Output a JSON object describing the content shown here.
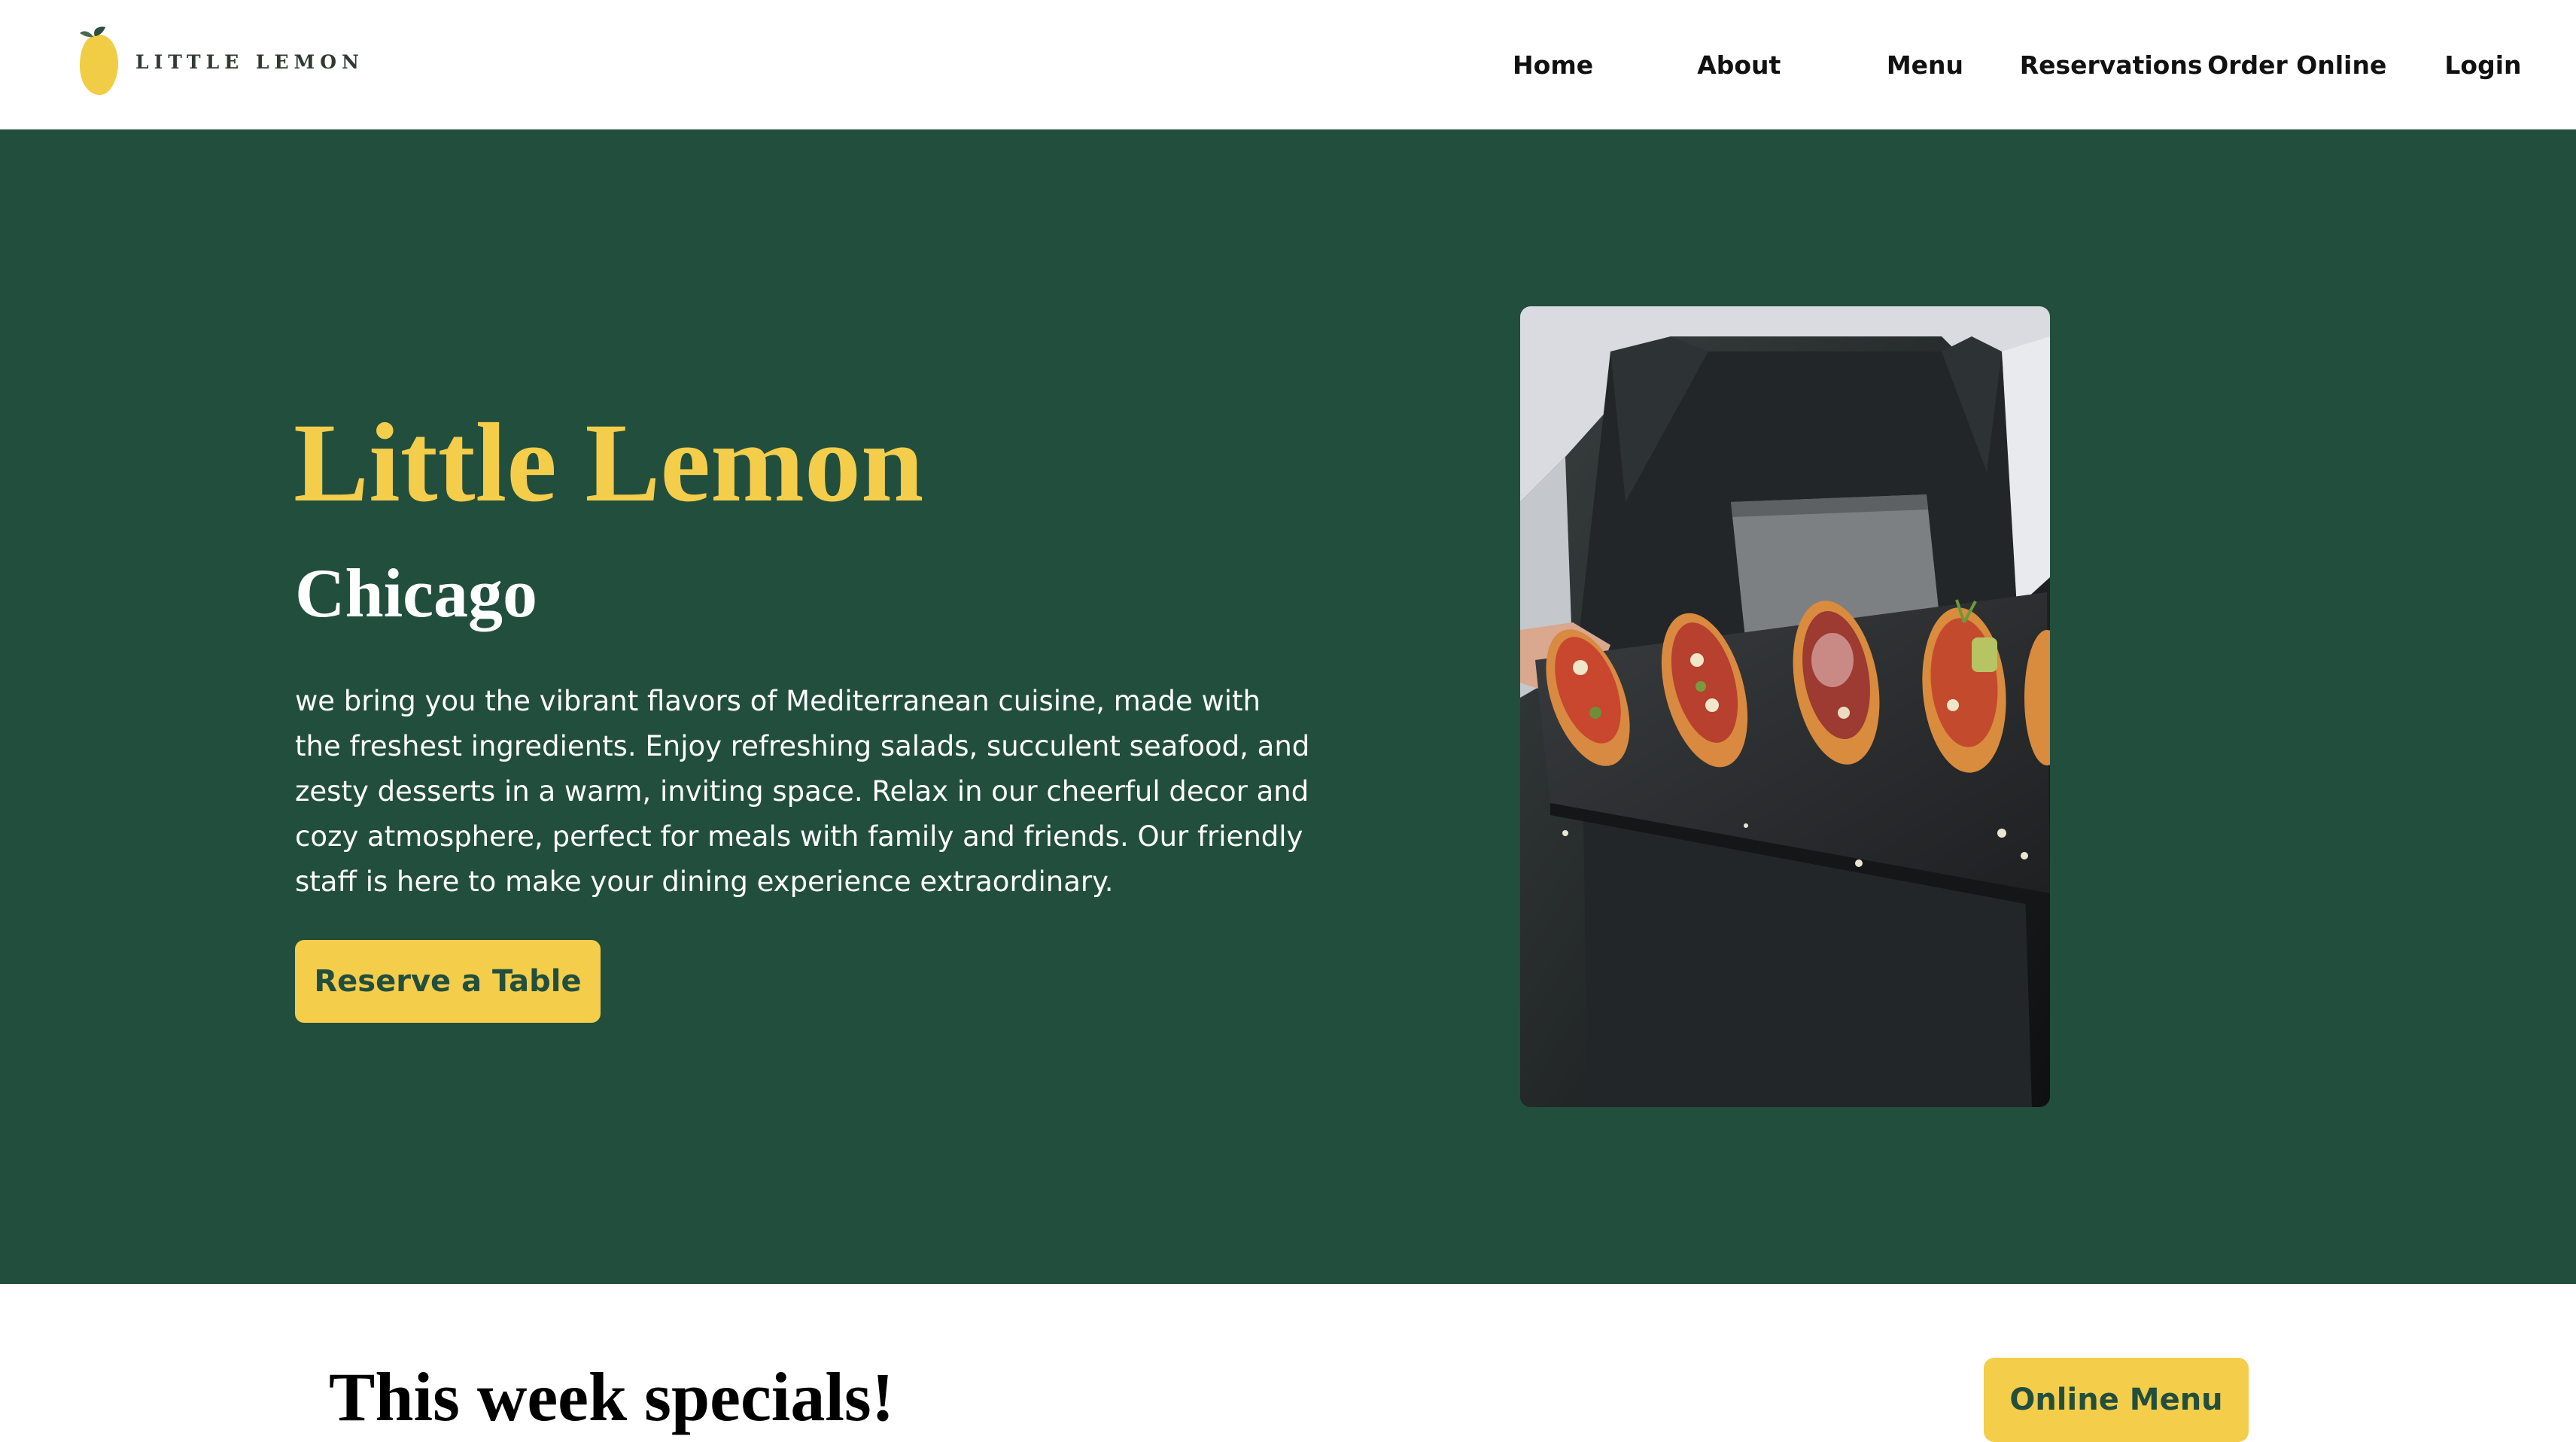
{
  "header": {
    "logo_text": "LITTLE LEMON",
    "nav": [
      {
        "label": "Home"
      },
      {
        "label": "About"
      },
      {
        "label": "Menu"
      },
      {
        "label": "Reservations"
      },
      {
        "label": "Order Online"
      },
      {
        "label": "Login"
      }
    ]
  },
  "hero": {
    "title": "Little Lemon",
    "subtitle": "Chicago",
    "description": "we bring you the vibrant flavors of Mediterranean cuisine, made with the freshest ingredients. Enjoy refreshing salads, succulent seafood, and zesty desserts in a warm, inviting space. Relax in our cheerful decor and cozy atmosphere, perfect for meals with family and friends. Our friendly staff is here to make your dining experience extraordinary.",
    "reserve_label": "Reserve a Table"
  },
  "specials": {
    "title": "This week specials!",
    "online_menu_label": "Online Menu"
  },
  "colors": {
    "brand_green": "#224e3e",
    "brand_yellow": "#f4cd4a",
    "background": "#ffffff"
  }
}
